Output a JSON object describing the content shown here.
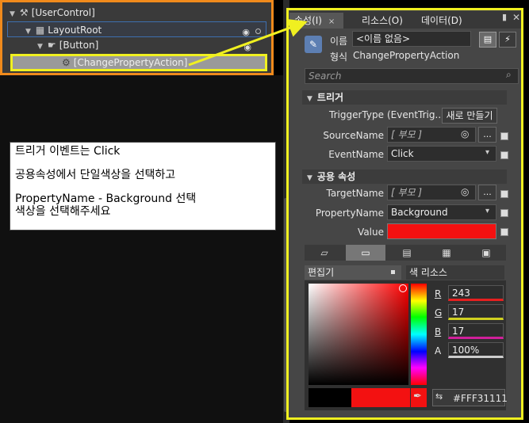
{
  "tree": {
    "items": [
      {
        "label": "[UserControl]"
      },
      {
        "label": "LayoutRoot"
      },
      {
        "label": "[Button]"
      },
      {
        "label": "[ChangePropertyAction]"
      }
    ]
  },
  "note": {
    "line1": "트리거 이벤트는 Click",
    "line2": "공용속성에서 단일색상을 선택하고",
    "line3": "PropertyName - Background 선택",
    "line4": "색상을 선택해주세요"
  },
  "tabs": {
    "properties": "속성(I)",
    "properties_close": "×",
    "resources": "리소스(O)",
    "data": "데이터(D)"
  },
  "header": {
    "name_label": "이름",
    "name_value": "<이름 없음>",
    "type_label": "형식",
    "type_value": "ChangePropertyAction"
  },
  "search": {
    "placeholder": "Search"
  },
  "trigger": {
    "title": "트리거",
    "trigger_type_label": "TriggerType",
    "trigger_type_value": "(EventTrig...",
    "new_button": "새로 만들기",
    "source_name_label": "SourceName",
    "source_name_value": "[ 부모 ]",
    "ellipsis": "...",
    "event_name_label": "EventName",
    "event_name_value": "Click"
  },
  "common": {
    "title": "공용 속성",
    "target_name_label": "TargetName",
    "target_name_value": "[ 부모 ]",
    "ellipsis": "...",
    "property_name_label": "PropertyName",
    "property_name_value": "Background",
    "value_label": "Value",
    "value_color": "#F31111"
  },
  "brush_editor": {
    "tab_editor": "편집기",
    "tab_color_resources": "색 리소스",
    "r_label": "R",
    "r_value": "243",
    "g_label": "G",
    "g_value": "17",
    "b_label": "B",
    "b_value": "17",
    "a_label": "A",
    "a_value": "100%",
    "hex_value": "#FFF31111"
  },
  "colors": {
    "highlight_yellow": "#F0F020",
    "tree_orange": "#F08A1C",
    "selected_red": "#F31111"
  }
}
